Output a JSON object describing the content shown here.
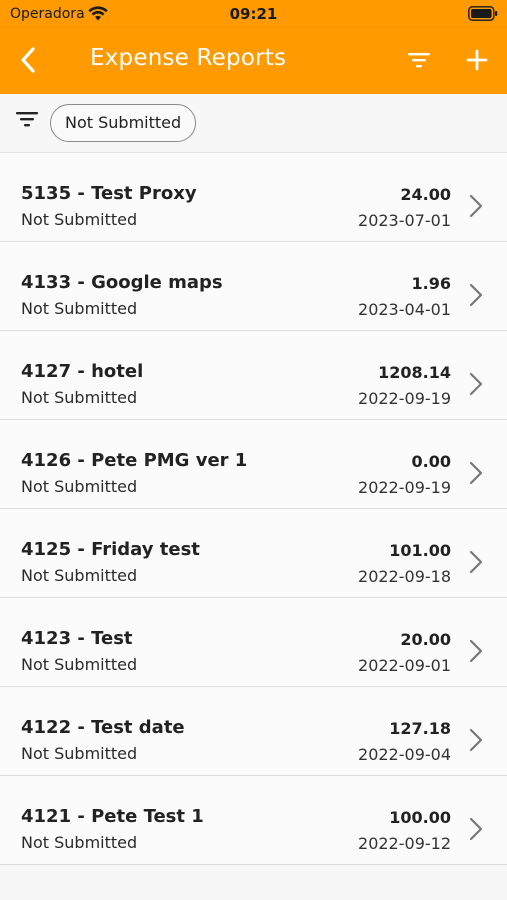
{
  "status_bar": {
    "carrier": "Operadora",
    "time": "09:21"
  },
  "nav": {
    "title": "Expense Reports",
    "accent_color": "#ff9a00",
    "icons": [
      "chevron-left-icon",
      "filter-icon",
      "plus-icon"
    ]
  },
  "filter": {
    "chip_label": "Not Submitted"
  },
  "reports": [
    {
      "title": "5135 - Test Proxy",
      "status": "Not Submitted",
      "amount": "24.00",
      "date": "2023-07-01"
    },
    {
      "title": "4133 - Google maps",
      "status": "Not Submitted",
      "amount": "1.96",
      "date": "2023-04-01"
    },
    {
      "title": "4127 - hotel",
      "status": "Not Submitted",
      "amount": "1208.14",
      "date": "2022-09-19"
    },
    {
      "title": "4126 - Pete PMG ver 1",
      "status": "Not Submitted",
      "amount": "0.00",
      "date": "2022-09-19"
    },
    {
      "title": "4125 - Friday test",
      "status": "Not Submitted",
      "amount": "101.00",
      "date": "2022-09-18"
    },
    {
      "title": "4123 - Test",
      "status": "Not Submitted",
      "amount": "20.00",
      "date": "2022-09-01"
    },
    {
      "title": "4122 - Test date",
      "status": "Not Submitted",
      "amount": "127.18",
      "date": "2022-09-04"
    },
    {
      "title": "4121 - Pete Test 1",
      "status": "Not Submitted",
      "amount": "100.00",
      "date": "2022-09-12"
    }
  ]
}
